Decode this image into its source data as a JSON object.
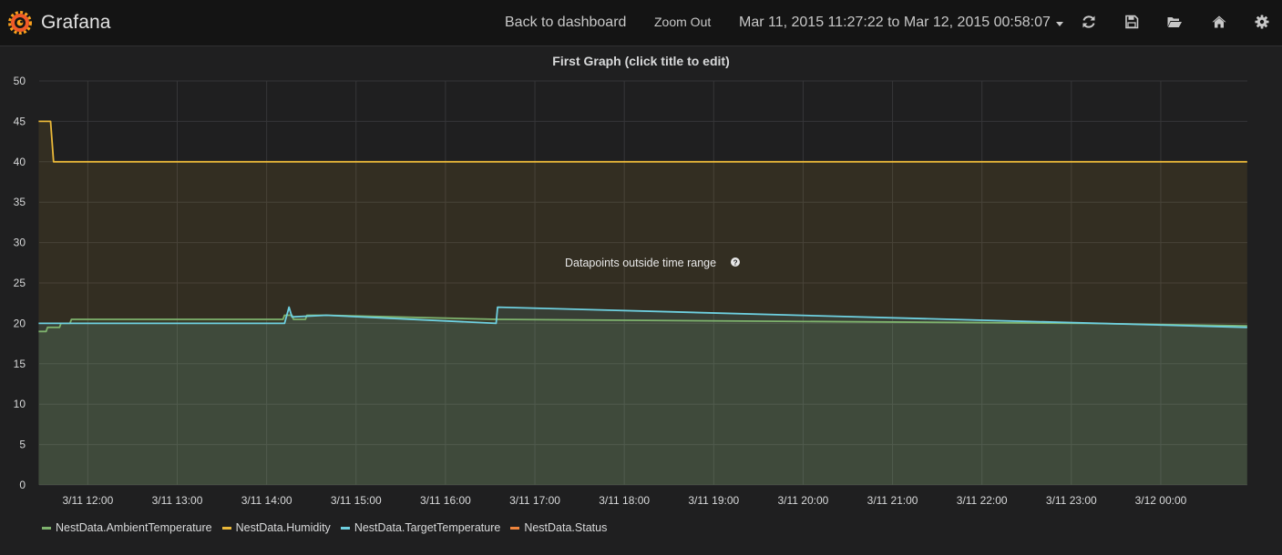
{
  "navbar": {
    "brand": "Grafana",
    "back_label": "Back to dashboard",
    "zoom_label": "Zoom Out",
    "time_range": "Mar 11, 2015 11:27:22 to Mar 12, 2015 00:58:07",
    "icons": [
      "refresh-icon",
      "save-icon",
      "folder-open-icon",
      "home-icon",
      "gear-icon"
    ]
  },
  "panel": {
    "title": "First Graph (click title to edit)",
    "notice": "Datapoints outside time range",
    "notice_icon": "question-circle-icon"
  },
  "colors": {
    "navbar_bg": "#141414",
    "panel_bg": "#1f1f20",
    "grid": "#363638",
    "ambient": "#7eb26d",
    "humidity": "#eab839",
    "target": "#6ed0e0",
    "status": "#ef843c"
  },
  "chart_data": {
    "type": "area",
    "title": "First Graph (click title to edit)",
    "x_type": "time",
    "xlim": [
      "2015-03-11 11:27:22",
      "2015-03-12 00:58:07"
    ],
    "x_ticks": [
      "3/11 12:00",
      "3/11 13:00",
      "3/11 14:00",
      "3/11 15:00",
      "3/11 16:00",
      "3/11 17:00",
      "3/11 18:00",
      "3/11 19:00",
      "3/11 20:00",
      "3/11 21:00",
      "3/11 22:00",
      "3/11 23:00",
      "3/12 00:00"
    ],
    "ylim": [
      0,
      50
    ],
    "y_ticks": [
      0,
      5,
      10,
      15,
      20,
      25,
      30,
      35,
      40,
      45,
      50
    ],
    "grid": true,
    "legend_position": "bottom-left",
    "series": [
      {
        "name": "NestData.AmbientTemperature",
        "color": "#7eb26d",
        "points": [
          [
            "11:27",
            19
          ],
          [
            "11:32",
            19
          ],
          [
            "11:33",
            19.5
          ],
          [
            "11:41",
            19.5
          ],
          [
            "11:42",
            20
          ],
          [
            "11:48",
            20
          ],
          [
            "11:49",
            20.5
          ],
          [
            "14:11",
            20.5
          ],
          [
            "14:12",
            21
          ],
          [
            "14:17",
            21
          ],
          [
            "14:18",
            20.5
          ],
          [
            "14:26",
            20.5
          ],
          [
            "14:27",
            21
          ],
          [
            "14:40",
            21
          ],
          [
            "16:35",
            20.5
          ],
          [
            "23:10",
            20
          ],
          [
            "00:58",
            19.7
          ]
        ]
      },
      {
        "name": "NestData.Humidity",
        "color": "#eab839",
        "points": [
          [
            "11:27",
            45
          ],
          [
            "11:35",
            45
          ],
          [
            "11:37",
            40
          ],
          [
            "00:58",
            40
          ]
        ]
      },
      {
        "name": "NestData.TargetTemperature",
        "color": "#6ed0e0",
        "points": [
          [
            "11:27",
            20
          ],
          [
            "14:12",
            20
          ],
          [
            "14:15",
            22
          ],
          [
            "14:17",
            20.8
          ],
          [
            "14:40",
            21
          ],
          [
            "16:34",
            20
          ],
          [
            "16:35",
            22
          ],
          [
            "00:58",
            19.5
          ]
        ]
      },
      {
        "name": "NestData.Status",
        "color": "#ef843c",
        "points": []
      }
    ]
  }
}
